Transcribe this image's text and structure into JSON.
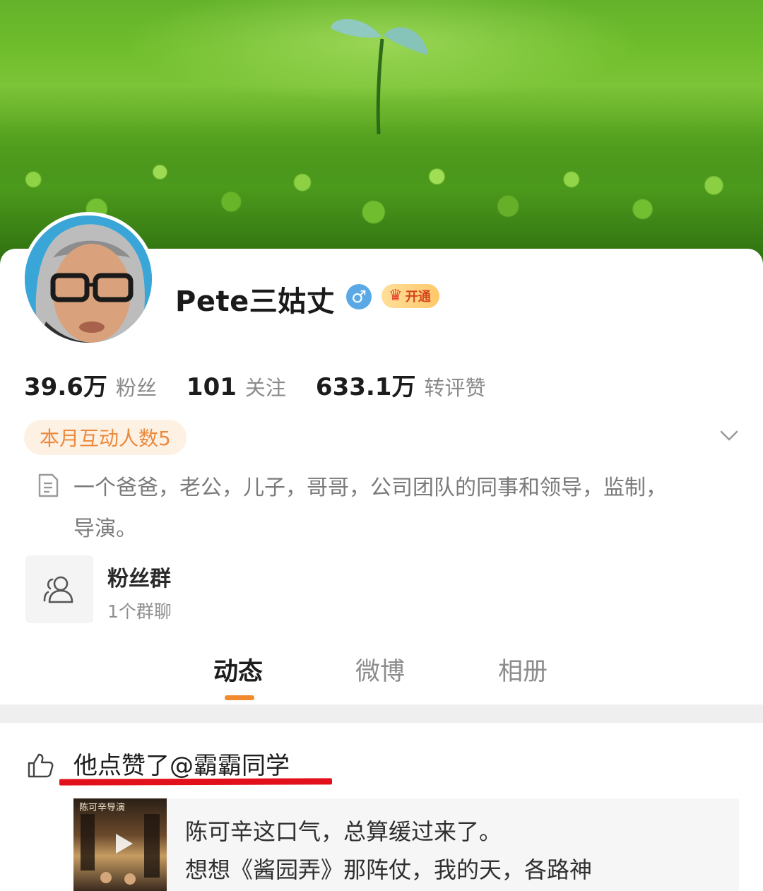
{
  "profile": {
    "username": "Pete三姑丈",
    "gender_symbol": "♂",
    "vip_label": "开通",
    "stats": [
      {
        "value": "39.6万",
        "label": "粉丝"
      },
      {
        "value": "101",
        "label": "关注"
      },
      {
        "value": "633.1万",
        "label": "转评赞"
      }
    ],
    "interaction_badge": "本月互动人数5",
    "bio_line1": "一个爸爸，老公，儿子，哥哥，公司团队的同事和领导，监制，",
    "bio_line2": "导演。",
    "fan_group": {
      "title": "粉丝群",
      "subtitle": "1个群聊"
    }
  },
  "tabs": [
    {
      "label": "动态",
      "active": true
    },
    {
      "label": "微博",
      "active": false
    },
    {
      "label": "相册",
      "active": false
    }
  ],
  "feed": {
    "like_text": "他点赞了@霸霸同学",
    "post_line1": "陈可辛这口气，总算缓过来了。",
    "post_line2": "想想《酱园弄》那阵仗，我的天，各路神",
    "thumb_caption": "陈可辛导演"
  },
  "colors": {
    "accent_orange": "#f08a2c",
    "badge_text": "#ec8a3c",
    "annotation_red": "#e1101a",
    "gender_blue": "#5aa9e6"
  },
  "icons": [
    "gender-male-icon",
    "vip-crown-icon",
    "chevron-down-icon",
    "document-icon",
    "group-icon",
    "thumbs-up-icon",
    "play-icon"
  ]
}
